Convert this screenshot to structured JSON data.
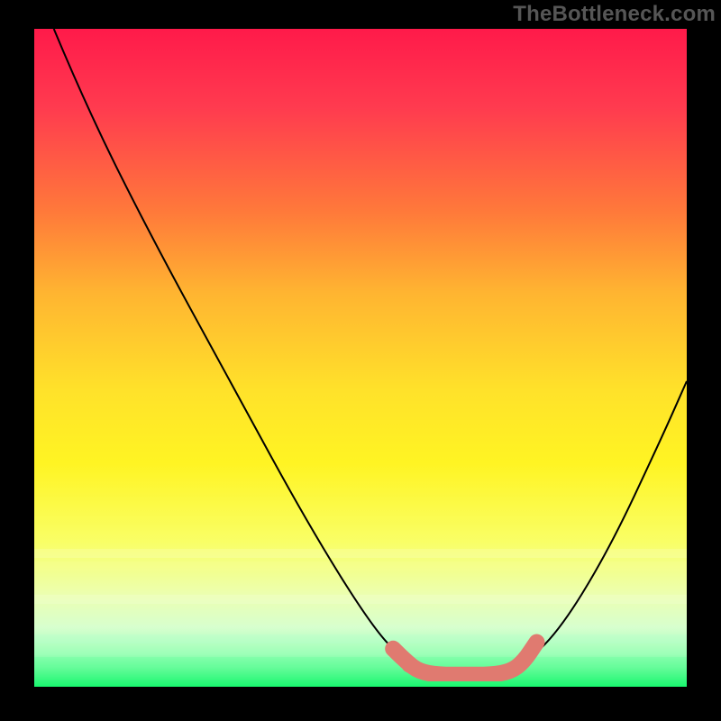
{
  "watermark": "TheBottleneck.com",
  "chart_data": {
    "type": "line",
    "title": "",
    "xlabel": "",
    "ylabel": "",
    "xlim": [
      0,
      100
    ],
    "ylim": [
      0,
      100
    ],
    "grid": false,
    "legend": false,
    "gradient_stops": [
      {
        "pos": 0,
        "color": "#ff1a4a"
      },
      {
        "pos": 12,
        "color": "#ff3b4f"
      },
      {
        "pos": 28,
        "color": "#ff7a3a"
      },
      {
        "pos": 40,
        "color": "#ffb431"
      },
      {
        "pos": 55,
        "color": "#ffe22a"
      },
      {
        "pos": 66,
        "color": "#fff423"
      },
      {
        "pos": 78,
        "color": "#f9ff66"
      },
      {
        "pos": 86,
        "color": "#ecffb0"
      },
      {
        "pos": 91,
        "color": "#d7ffce"
      },
      {
        "pos": 95,
        "color": "#9dffb8"
      },
      {
        "pos": 100,
        "color": "#19f76f"
      }
    ],
    "series": [
      {
        "name": "bottleneck-curve",
        "color": "#000000",
        "points": [
          {
            "x": 3,
            "y": 100
          },
          {
            "x": 8,
            "y": 88
          },
          {
            "x": 18,
            "y": 68
          },
          {
            "x": 30,
            "y": 46
          },
          {
            "x": 42,
            "y": 24
          },
          {
            "x": 52,
            "y": 8
          },
          {
            "x": 57,
            "y": 3
          },
          {
            "x": 62,
            "y": 1
          },
          {
            "x": 68,
            "y": 1
          },
          {
            "x": 74,
            "y": 2
          },
          {
            "x": 80,
            "y": 7
          },
          {
            "x": 88,
            "y": 20
          },
          {
            "x": 96,
            "y": 37
          },
          {
            "x": 100,
            "y": 46
          }
        ]
      },
      {
        "name": "optimal-range-marker",
        "color": "#e07a70",
        "thick": true,
        "points": [
          {
            "x": 55,
            "y": 5
          },
          {
            "x": 57,
            "y": 3
          },
          {
            "x": 59,
            "y": 1.5
          },
          {
            "x": 62,
            "y": 1
          },
          {
            "x": 66,
            "y": 1
          },
          {
            "x": 70,
            "y": 1
          },
          {
            "x": 73,
            "y": 1.5
          },
          {
            "x": 75,
            "y": 3
          },
          {
            "x": 77,
            "y": 6
          }
        ]
      }
    ],
    "marker_dots": [
      {
        "x": 55,
        "y": 5
      },
      {
        "x": 57.5,
        "y": 2.5
      }
    ]
  }
}
